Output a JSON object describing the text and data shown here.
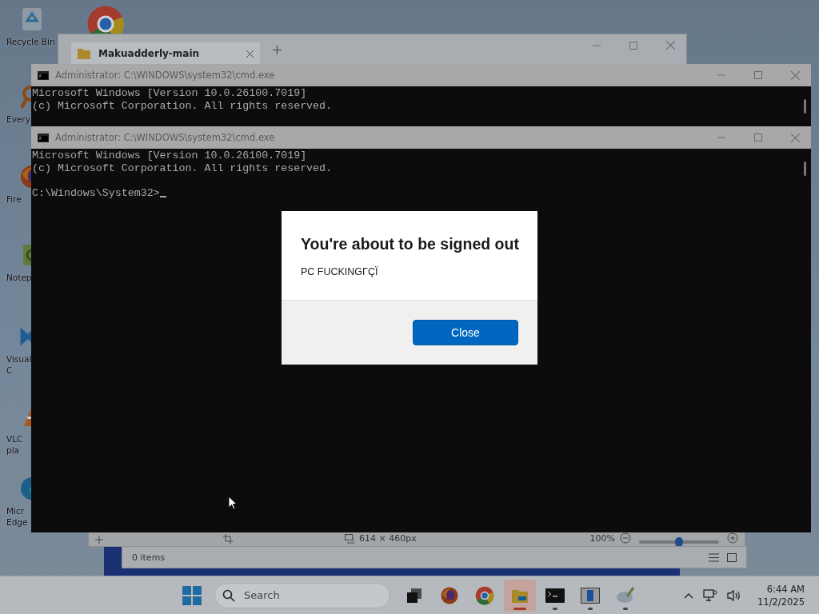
{
  "desktop_icons": [
    {
      "kind": "recycle",
      "label": [
        "Recycle Bin"
      ]
    },
    {
      "kind": "chrome"
    },
    {
      "kind": "everything",
      "label": [
        "Every"
      ]
    },
    {
      "kind": "firefox",
      "label": [
        "Fire"
      ]
    },
    {
      "kind": "notepad",
      "label": [
        "Notep"
      ]
    },
    {
      "kind": "vscode",
      "label": [
        "Visual",
        "C"
      ]
    },
    {
      "kind": "vlc",
      "label": [
        "VLC",
        "pla"
      ]
    },
    {
      "kind": "edge",
      "label": [
        "Micr",
        "Edge"
      ]
    }
  ],
  "file_explorer": {
    "tab_title": "Makuadderly-main",
    "status": "0 items"
  },
  "photo_viewer": {
    "dimensions": "614 × 460px",
    "zoom": "100%",
    "zoom_slider": {
      "level": 0.5
    }
  },
  "cmd_windows": [
    {
      "title": "Administrator: C:\\WINDOWS\\system32\\cmd.exe",
      "lines": [
        "Microsoft Windows [Version 10.0.26100.7019]",
        "(c) Microsoft Corporation. All rights reserved."
      ]
    },
    {
      "title": "Administrator: C:\\WINDOWS\\system32\\cmd.exe",
      "lines": [
        "Microsoft Windows [Version 10.0.26100.7019]",
        "(c) Microsoft Corporation. All rights reserved."
      ],
      "prompt": "C:\\Windows\\System32>",
      "cursor_visible": true
    }
  ],
  "dialog": {
    "title": "You're about to be signed out",
    "message": "PC FUCKINGΓÇÏ",
    "button": "Close"
  },
  "taskbar": {
    "search_placeholder": "Search",
    "apps": [
      {
        "kind": "taskview",
        "running": false,
        "selected": false
      },
      {
        "kind": "firefox",
        "running": false,
        "selected": false
      },
      {
        "kind": "chrome",
        "running": false,
        "selected": false
      },
      {
        "kind": "explorer",
        "running": true,
        "selected": true
      },
      {
        "kind": "terminal",
        "running": true,
        "selected": false
      },
      {
        "kind": "window",
        "running": true,
        "selected": false
      },
      {
        "kind": "paint",
        "running": true,
        "selected": false
      }
    ],
    "time": "6:44 AM",
    "date": "11/2/2025"
  }
}
